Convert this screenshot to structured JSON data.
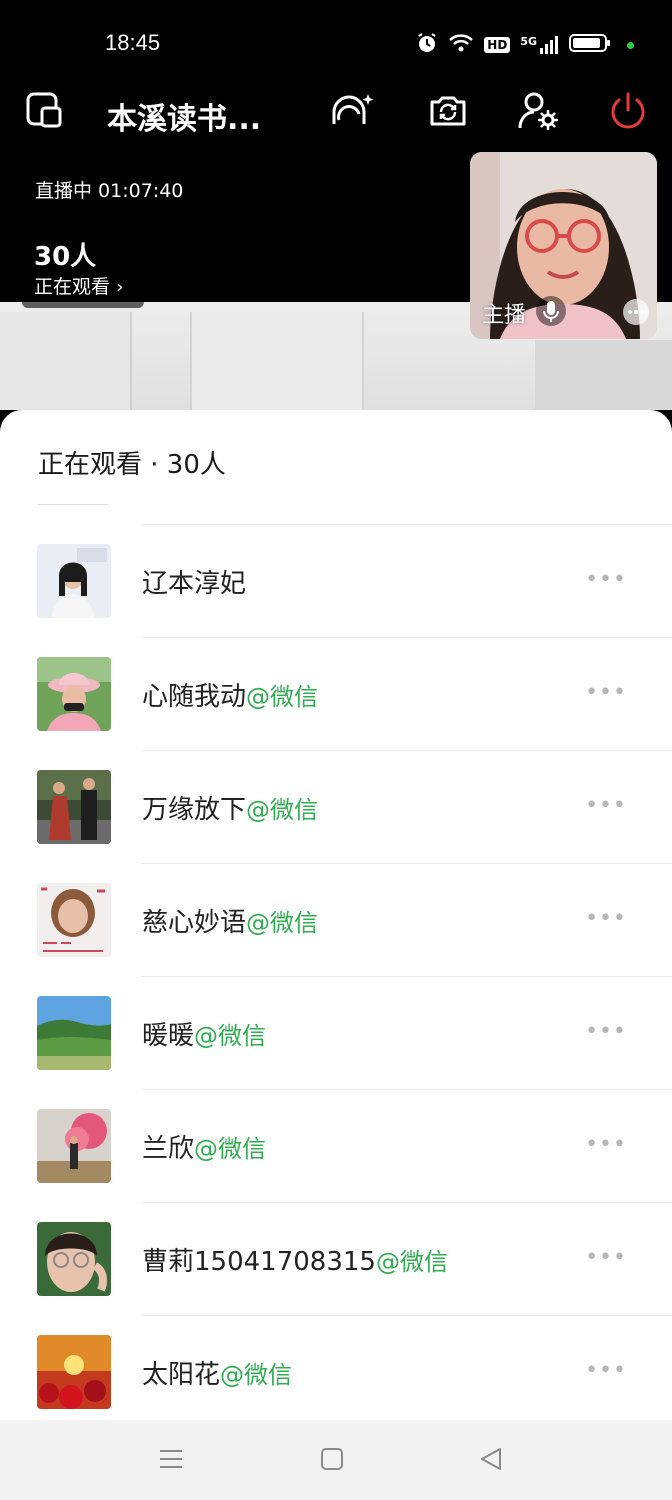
{
  "status_bar": {
    "time": "18:45",
    "network": "5G",
    "hd": "HD"
  },
  "toolbar": {
    "room_title": "本溪读书..."
  },
  "live": {
    "status": "直播中 01:07:40",
    "viewer_count": "30人",
    "viewer_label": "正在观看 ›"
  },
  "host_cam": {
    "label": "主播"
  },
  "sheet": {
    "title": "正在观看 · 30人",
    "viewers": [
      {
        "name": "辽本淳妃",
        "source": ""
      },
      {
        "name": "心随我动",
        "source": "@微信"
      },
      {
        "name": "万缘放下",
        "source": "@微信"
      },
      {
        "name": "慈心妙语",
        "source": "@微信"
      },
      {
        "name": "暖暖",
        "source": "@微信"
      },
      {
        "name": "兰欣",
        "source": "@微信"
      },
      {
        "name": "曹莉15041708315",
        "source": "@微信"
      },
      {
        "name": "太阳花",
        "source": "@微信"
      }
    ],
    "more_label": "•••"
  },
  "colors": {
    "accent_green": "#2fae4f",
    "power_red": "#e5393d"
  }
}
